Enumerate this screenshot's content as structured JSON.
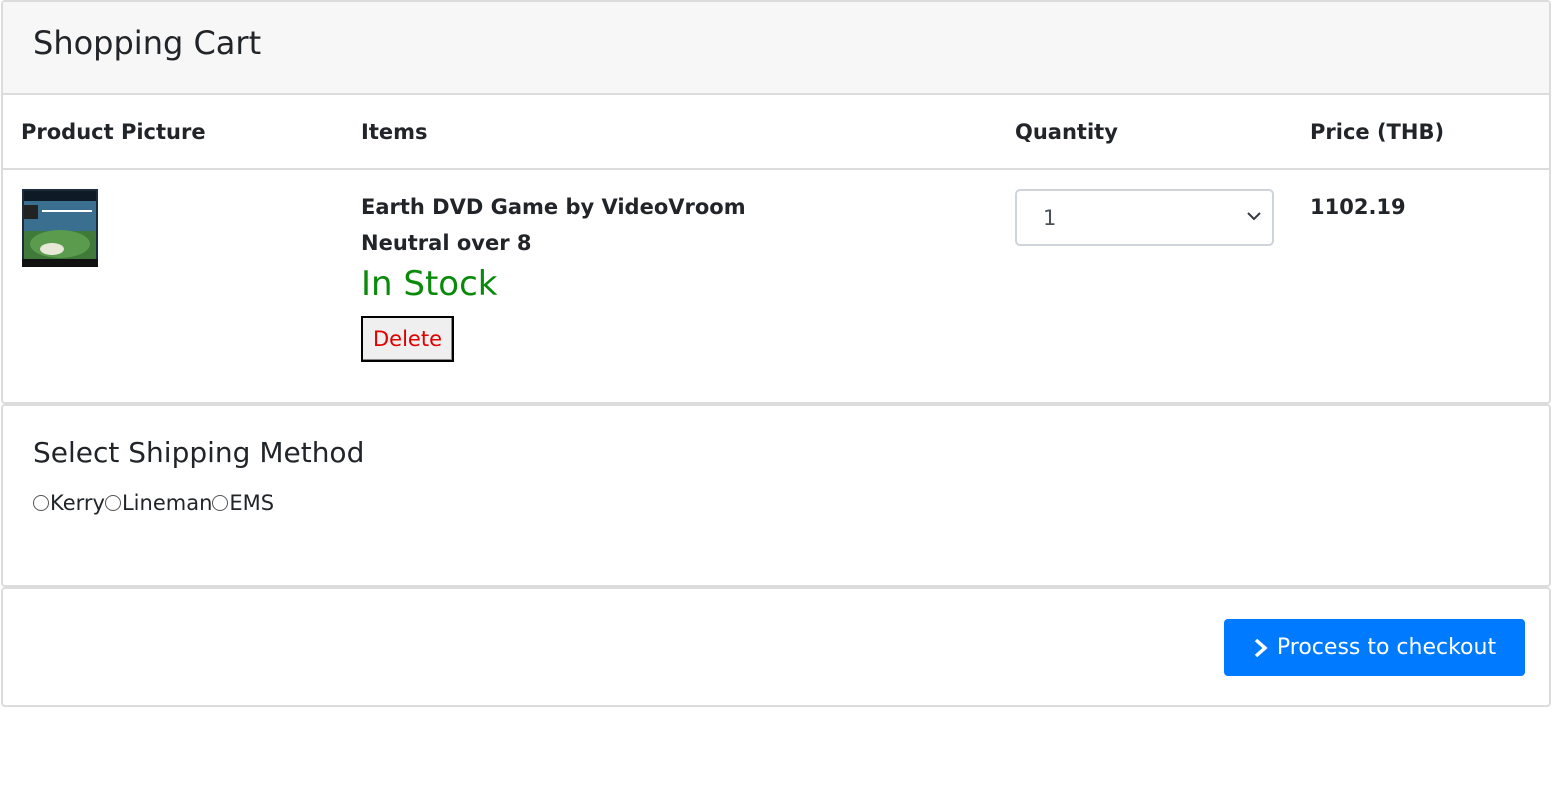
{
  "cart": {
    "title": "Shopping Cart",
    "columns": {
      "picture": "Product Picture",
      "items": "Items",
      "quantity": "Quantity",
      "price": "Price (THB)"
    },
    "item": {
      "name": "Earth DVD Game by VideoVroom",
      "subtitle": "Neutral over 8",
      "stock_status": "In Stock",
      "stock_color": "#0a8a0a",
      "delete_label": "Delete",
      "quantity": "1",
      "price": "1102.19",
      "picture_icon": "product-thumbnail-icon"
    }
  },
  "shipping": {
    "title": "Select Shipping Method",
    "options": [
      "Kerry",
      "Lineman",
      "EMS"
    ]
  },
  "checkout": {
    "button_label": "Process to checkout",
    "button_color": "#007bff",
    "icon": "chevron-right-icon"
  }
}
